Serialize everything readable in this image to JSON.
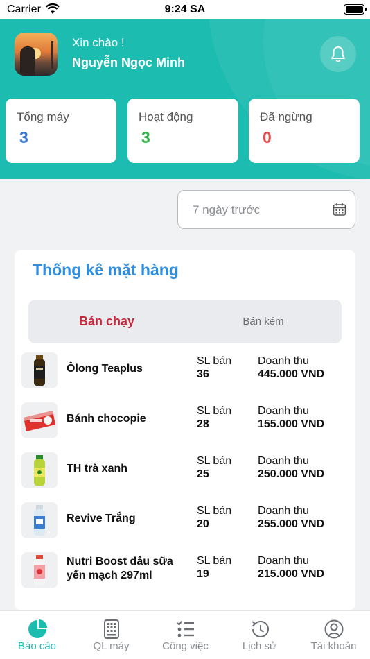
{
  "status_bar": {
    "carrier": "Carrier",
    "time": "9:24 SA"
  },
  "header": {
    "greeting": "Xin chào !",
    "user_name": "Nguyễn Ngọc Minh",
    "icon": "bell-icon"
  },
  "stats": [
    {
      "label": "Tổng máy",
      "value": "3",
      "color": "#3b7bd4"
    },
    {
      "label": "Hoạt động",
      "value": "3",
      "color": "#33b44c"
    },
    {
      "label": "Đã ngừng",
      "value": "0",
      "color": "#e74d4d"
    }
  ],
  "date_filter": {
    "value": "7 ngày trước",
    "icon": "calendar-icon"
  },
  "items_panel": {
    "title": "Thống kê mặt hàng",
    "tabs": [
      "Bán chạy",
      "Bán kém"
    ],
    "active_tab": "Bán chạy",
    "quantity_label": "SL bán",
    "revenue_label": "Doanh thu",
    "items": [
      {
        "name": "Ôlong Teaplus",
        "quantity": "36",
        "revenue": "445.000 VND"
      },
      {
        "name": "Bánh chocopie",
        "quantity": "28",
        "revenue": "155.000 VND"
      },
      {
        "name": "TH trà xanh",
        "quantity": "25",
        "revenue": "250.000 VND"
      },
      {
        "name": "Revive Trắng",
        "quantity": "20",
        "revenue": "255.000 VND"
      },
      {
        "name": "Nutri Boost dâu sữa yến mạch 297ml",
        "quantity": "19",
        "revenue": "215.000 VND"
      }
    ]
  },
  "tabbar": {
    "tabs": [
      {
        "label": "Báo cáo",
        "icon": "pie-chart-icon",
        "active": true
      },
      {
        "label": "QL máy",
        "icon": "vending-machine-icon",
        "active": false
      },
      {
        "label": "Công việc",
        "icon": "checklist-icon",
        "active": false
      },
      {
        "label": "Lịch sử",
        "icon": "history-icon",
        "active": false
      },
      {
        "label": "Tài khoản",
        "icon": "account-icon",
        "active": false
      }
    ]
  },
  "colors": {
    "primary": "#1cbcb0",
    "title_blue": "#2e8fe0",
    "active_tab_red": "#c8283c"
  }
}
